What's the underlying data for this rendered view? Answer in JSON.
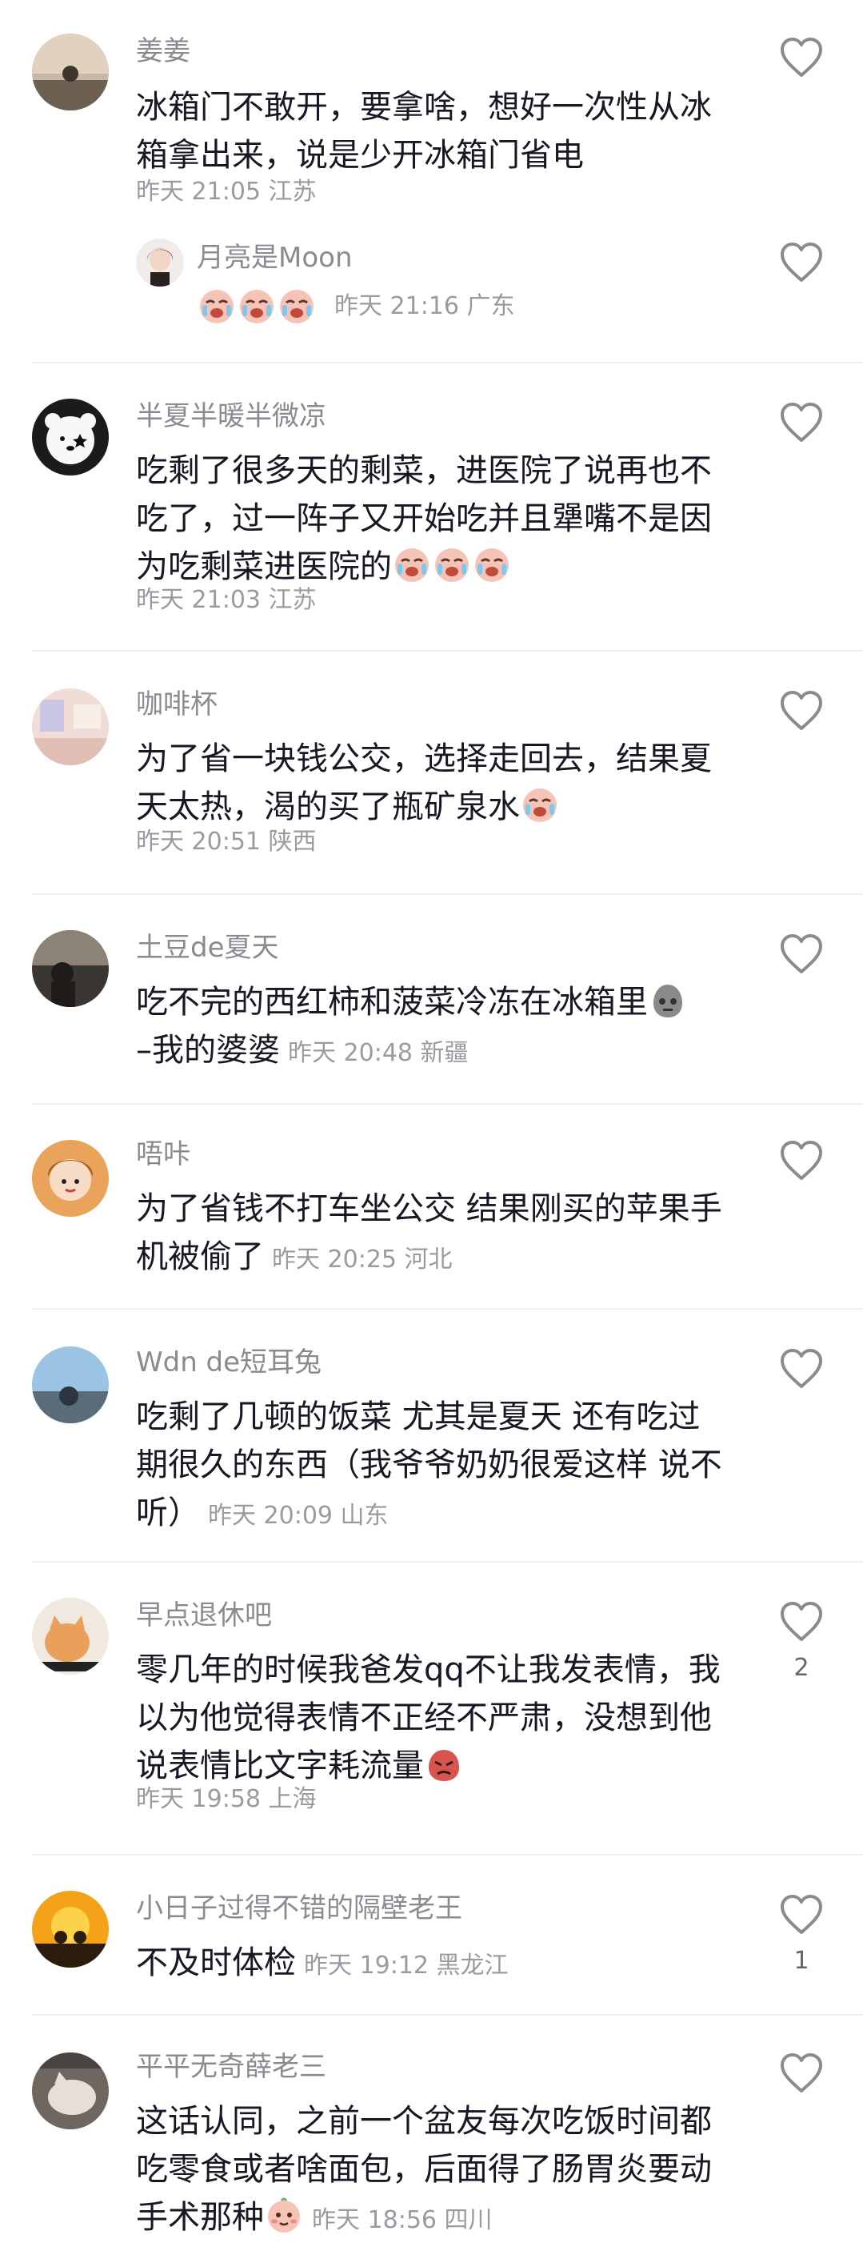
{
  "comments": [
    {
      "user": "姜姜",
      "text": "冰箱门不敢开，要拿啥，想好一次性从冰箱拿出来，说是少开冰箱门省电",
      "time": "昨天 21:05 江苏",
      "avatar_icon": "dusk-landscape-avatar",
      "reply": {
        "user": "月亮是Moon",
        "time": "昨天 21:16 广东",
        "avatar_icon": "woman-portrait-avatar",
        "emoji_icon": "crying-laughing-emoji"
      }
    },
    {
      "user": "半夏半暖半微凉",
      "text": "吃剩了很多天的剩菜，进医院了说再也不吃了，过一阵子又开始吃并且犟嘴不是因为吃剩菜进医院的",
      "time": "昨天 21:03 江苏",
      "avatar_icon": "bear-avatar",
      "emoji_icon": "crying-laughing-emoji"
    },
    {
      "user": "咖啡杯",
      "text": "为了省一块钱公交，选择走回去，结果夏天太热，渴的买了瓶矿泉水",
      "time": "昨天 20:51 陕西",
      "avatar_icon": "pastel-room-avatar",
      "emoji_icon": "crying-laughing-emoji"
    },
    {
      "user": "土豆de夏天",
      "text": "吃不完的西红柿和菠菜冷冻在冰箱里",
      "text2": "–我的婆婆",
      "time": "昨天 20:48 新疆",
      "avatar_icon": "street-scene-avatar",
      "emoji_icon": "speechless-gray-emoji"
    },
    {
      "user": "唔咔",
      "text": "为了省钱不打车坐公交 结果刚买的苹果手机被偷了",
      "time": "昨天 20:25 河北",
      "avatar_icon": "girl-cartoon-avatar"
    },
    {
      "user": "Wdn de短耳兔",
      "text": "吃剩了几顿的饭菜 尤其是夏天 还有吃过期很久的东西（我爷爷奶奶很爱这样 说不听）",
      "time": "昨天 20:09 山东",
      "avatar_icon": "sky-photo-avatar"
    },
    {
      "user": "早点退休吧",
      "text": "零几年的时候我爸发qq不让我发表情，我以为他觉得表情不正经不严肃，没想到他说表情比文字耗流量",
      "time": "昨天 19:58 上海",
      "avatar_icon": "cat-meme-avatar",
      "emoji_icon": "angry-red-emoji",
      "likes": "2"
    },
    {
      "user": "小日子过得不错的隔壁老王",
      "text": "不及时体检",
      "time": "昨天 19:12 黑龙江",
      "avatar_icon": "sunset-silhouette-avatar",
      "likes": "1"
    },
    {
      "user": "平平无奇薛老三",
      "text": "这话认同，之前一个盆友每次吃饭时间都吃零食或者啥面包，后面得了肠胃炎要动手术那种",
      "time": "昨天 18:56 四川",
      "avatar_icon": "cat-photo-avatar",
      "emoji_icon": "shy-smile-emoji"
    }
  ],
  "colors": {
    "username": "#8a8b91",
    "meta": "#9a9ba1",
    "text": "#161823"
  }
}
